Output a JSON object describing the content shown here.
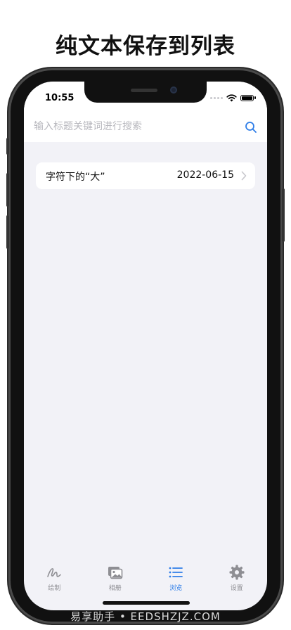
{
  "headline": "纯文本保存到列表",
  "status_bar": {
    "time": "10:55"
  },
  "search": {
    "placeholder": "输入标题关键词进行搜索",
    "value": ""
  },
  "list": {
    "items": [
      {
        "title": "字符下的“大”",
        "date": "2022-06-15"
      }
    ]
  },
  "tabs": [
    {
      "label": "绘制",
      "icon": "draw-icon",
      "active": false
    },
    {
      "label": "相册",
      "icon": "album-icon",
      "active": false
    },
    {
      "label": "浏览",
      "icon": "list-icon",
      "active": true
    },
    {
      "label": "设置",
      "icon": "gear-icon",
      "active": false
    }
  ],
  "watermark": "易享助手 • EEDSHZJZ.COM",
  "colors": {
    "accent": "#2f7ee8",
    "inactive": "#8e8e93",
    "background": "#f2f2f7"
  }
}
